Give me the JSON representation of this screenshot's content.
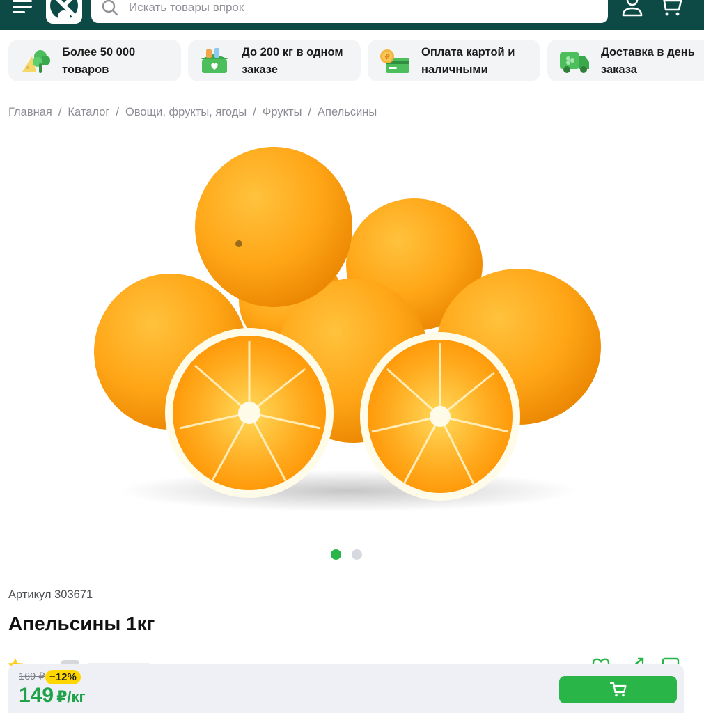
{
  "header": {
    "search_placeholder": "Искать товары впрок",
    "colors": {
      "background": "#0d4a45",
      "accent": "#2ab548"
    },
    "icons": [
      "menu-icon",
      "logo-icon",
      "search-icon",
      "user-icon",
      "cart-icon"
    ]
  },
  "features": [
    {
      "text": "Более 50 000 товаров",
      "icon": "groceries-icon"
    },
    {
      "text": "До 200 кг в одном заказе",
      "icon": "weight-box-icon"
    },
    {
      "text": "Оплата картой и наличными",
      "icon": "card-coin-icon"
    },
    {
      "text": "Доставка в день заказа",
      "icon": "delivery-truck-icon"
    }
  ],
  "breadcrumb": {
    "items": [
      "Главная",
      "Каталог",
      "Овощи, фрукты, ягоды",
      "Фрукты",
      "Апельсины"
    ],
    "separator": "/"
  },
  "gallery": {
    "slides": 2,
    "active": 1,
    "colors": {
      "active": "#2ab548",
      "inactive": "#d6d9e0"
    }
  },
  "product": {
    "sku_label": "Артикул 303671",
    "title": "Апельсины 1кг"
  },
  "buy_bar": {
    "old_price": "169 ₽",
    "discount": "−12%",
    "price": "149",
    "unit": "₽/кг",
    "button_icon": "cart-icon"
  }
}
